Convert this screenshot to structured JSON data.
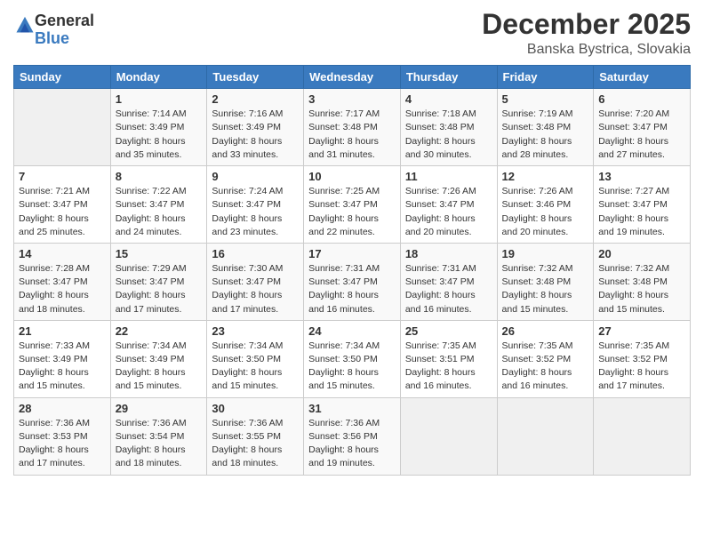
{
  "logo": {
    "general": "General",
    "blue": "Blue"
  },
  "header": {
    "month": "December 2025",
    "location": "Banska Bystrica, Slovakia"
  },
  "weekdays": [
    "Sunday",
    "Monday",
    "Tuesday",
    "Wednesday",
    "Thursday",
    "Friday",
    "Saturday"
  ],
  "weeks": [
    [
      {
        "day": "",
        "info": ""
      },
      {
        "day": "1",
        "info": "Sunrise: 7:14 AM\nSunset: 3:49 PM\nDaylight: 8 hours\nand 35 minutes."
      },
      {
        "day": "2",
        "info": "Sunrise: 7:16 AM\nSunset: 3:49 PM\nDaylight: 8 hours\nand 33 minutes."
      },
      {
        "day": "3",
        "info": "Sunrise: 7:17 AM\nSunset: 3:48 PM\nDaylight: 8 hours\nand 31 minutes."
      },
      {
        "day": "4",
        "info": "Sunrise: 7:18 AM\nSunset: 3:48 PM\nDaylight: 8 hours\nand 30 minutes."
      },
      {
        "day": "5",
        "info": "Sunrise: 7:19 AM\nSunset: 3:48 PM\nDaylight: 8 hours\nand 28 minutes."
      },
      {
        "day": "6",
        "info": "Sunrise: 7:20 AM\nSunset: 3:47 PM\nDaylight: 8 hours\nand 27 minutes."
      }
    ],
    [
      {
        "day": "7",
        "info": "Sunrise: 7:21 AM\nSunset: 3:47 PM\nDaylight: 8 hours\nand 25 minutes."
      },
      {
        "day": "8",
        "info": "Sunrise: 7:22 AM\nSunset: 3:47 PM\nDaylight: 8 hours\nand 24 minutes."
      },
      {
        "day": "9",
        "info": "Sunrise: 7:24 AM\nSunset: 3:47 PM\nDaylight: 8 hours\nand 23 minutes."
      },
      {
        "day": "10",
        "info": "Sunrise: 7:25 AM\nSunset: 3:47 PM\nDaylight: 8 hours\nand 22 minutes."
      },
      {
        "day": "11",
        "info": "Sunrise: 7:26 AM\nSunset: 3:47 PM\nDaylight: 8 hours\nand 20 minutes."
      },
      {
        "day": "12",
        "info": "Sunrise: 7:26 AM\nSunset: 3:46 PM\nDaylight: 8 hours\nand 20 minutes."
      },
      {
        "day": "13",
        "info": "Sunrise: 7:27 AM\nSunset: 3:47 PM\nDaylight: 8 hours\nand 19 minutes."
      }
    ],
    [
      {
        "day": "14",
        "info": "Sunrise: 7:28 AM\nSunset: 3:47 PM\nDaylight: 8 hours\nand 18 minutes."
      },
      {
        "day": "15",
        "info": "Sunrise: 7:29 AM\nSunset: 3:47 PM\nDaylight: 8 hours\nand 17 minutes."
      },
      {
        "day": "16",
        "info": "Sunrise: 7:30 AM\nSunset: 3:47 PM\nDaylight: 8 hours\nand 17 minutes."
      },
      {
        "day": "17",
        "info": "Sunrise: 7:31 AM\nSunset: 3:47 PM\nDaylight: 8 hours\nand 16 minutes."
      },
      {
        "day": "18",
        "info": "Sunrise: 7:31 AM\nSunset: 3:47 PM\nDaylight: 8 hours\nand 16 minutes."
      },
      {
        "day": "19",
        "info": "Sunrise: 7:32 AM\nSunset: 3:48 PM\nDaylight: 8 hours\nand 15 minutes."
      },
      {
        "day": "20",
        "info": "Sunrise: 7:32 AM\nSunset: 3:48 PM\nDaylight: 8 hours\nand 15 minutes."
      }
    ],
    [
      {
        "day": "21",
        "info": "Sunrise: 7:33 AM\nSunset: 3:49 PM\nDaylight: 8 hours\nand 15 minutes."
      },
      {
        "day": "22",
        "info": "Sunrise: 7:34 AM\nSunset: 3:49 PM\nDaylight: 8 hours\nand 15 minutes."
      },
      {
        "day": "23",
        "info": "Sunrise: 7:34 AM\nSunset: 3:50 PM\nDaylight: 8 hours\nand 15 minutes."
      },
      {
        "day": "24",
        "info": "Sunrise: 7:34 AM\nSunset: 3:50 PM\nDaylight: 8 hours\nand 15 minutes."
      },
      {
        "day": "25",
        "info": "Sunrise: 7:35 AM\nSunset: 3:51 PM\nDaylight: 8 hours\nand 16 minutes."
      },
      {
        "day": "26",
        "info": "Sunrise: 7:35 AM\nSunset: 3:52 PM\nDaylight: 8 hours\nand 16 minutes."
      },
      {
        "day": "27",
        "info": "Sunrise: 7:35 AM\nSunset: 3:52 PM\nDaylight: 8 hours\nand 17 minutes."
      }
    ],
    [
      {
        "day": "28",
        "info": "Sunrise: 7:36 AM\nSunset: 3:53 PM\nDaylight: 8 hours\nand 17 minutes."
      },
      {
        "day": "29",
        "info": "Sunrise: 7:36 AM\nSunset: 3:54 PM\nDaylight: 8 hours\nand 18 minutes."
      },
      {
        "day": "30",
        "info": "Sunrise: 7:36 AM\nSunset: 3:55 PM\nDaylight: 8 hours\nand 18 minutes."
      },
      {
        "day": "31",
        "info": "Sunrise: 7:36 AM\nSunset: 3:56 PM\nDaylight: 8 hours\nand 19 minutes."
      },
      {
        "day": "",
        "info": ""
      },
      {
        "day": "",
        "info": ""
      },
      {
        "day": "",
        "info": ""
      }
    ]
  ]
}
